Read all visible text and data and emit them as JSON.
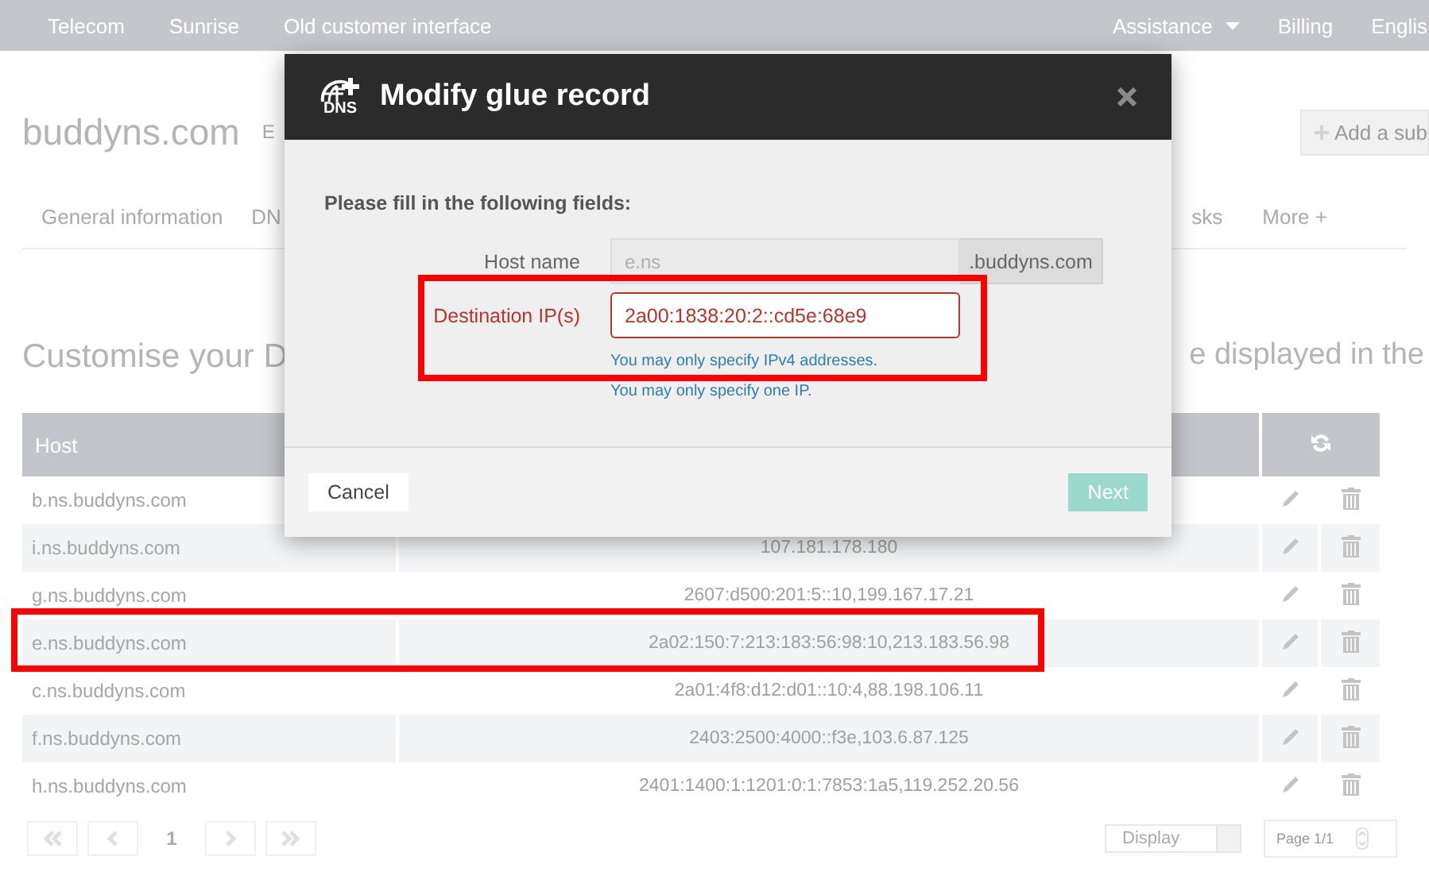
{
  "nav": {
    "left": [
      "Telecom",
      "Sunrise",
      "Old customer interface"
    ],
    "right": [
      {
        "label": "Assistance",
        "dropdown": true
      },
      {
        "label": "Billing",
        "dropdown": false
      },
      {
        "label": "Englis",
        "dropdown": false
      }
    ]
  },
  "page": {
    "title": "buddyns.com",
    "title_after": "E",
    "add_button": "Add a sub",
    "tabs_left": [
      "General information",
      "DN"
    ],
    "tabs_right": [
      "sks",
      "More +"
    ],
    "heading_left": "Customise your D",
    "heading_right": "e displayed in the"
  },
  "table": {
    "columns": [
      "Host"
    ],
    "rows": [
      {
        "host": "b.ns.buddyns.com"
      },
      {
        "host": "i.ns.buddyns.com",
        "ip": "107.181.178.180"
      },
      {
        "host": "g.ns.buddyns.com",
        "ip": "2607:d500:201:5::10,199.167.17.21"
      },
      {
        "host": "e.ns.buddyns.com",
        "ip": "2a02:150:7:213:183:56:98:10,213.183.56.98"
      },
      {
        "host": "c.ns.buddyns.com",
        "ip": "2a01:4f8:d12:d01::10:4,88.198.106.11"
      },
      {
        "host": "f.ns.buddyns.com",
        "ip": "2403:2500:4000::f3e,103.6.87.125"
      },
      {
        "host": "h.ns.buddyns.com",
        "ip": "2401:1400:1:1201:0:1:7853:1a5,119.252.20.56"
      }
    ]
  },
  "pager": {
    "page": "1",
    "display": "Display",
    "page_count": "Page 1/1"
  },
  "modal": {
    "logo_text": "DNS",
    "title": "Modify glue record",
    "intro": "Please fill in the following fields:",
    "fields": [
      {
        "kind": "addon",
        "label": "Host name",
        "placeholder": "e.ns",
        "suffix": ".buddyns.com",
        "error": false
      },
      {
        "kind": "text",
        "label": "Destination IP(s)",
        "value": "2a00:1838:20:2::cd5e:68e9",
        "error": true,
        "messages": [
          "You may only specify IPv4 addresses.",
          "You may only specify one IP."
        ]
      }
    ],
    "cancel": "Cancel",
    "next": {
      "label": "Next",
      "disabled": true
    }
  }
}
